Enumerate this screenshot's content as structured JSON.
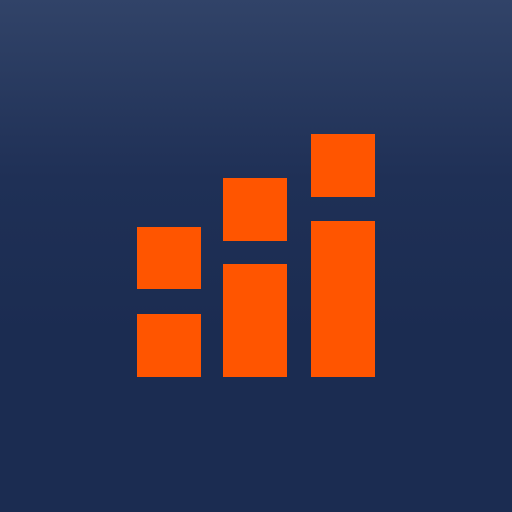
{
  "app_icon": {
    "icon_name": "bar-chart-blocks-icon",
    "colors": {
      "background_top": "#314368",
      "background_bottom": "#1b2c51",
      "accent": "#ff5500"
    }
  }
}
